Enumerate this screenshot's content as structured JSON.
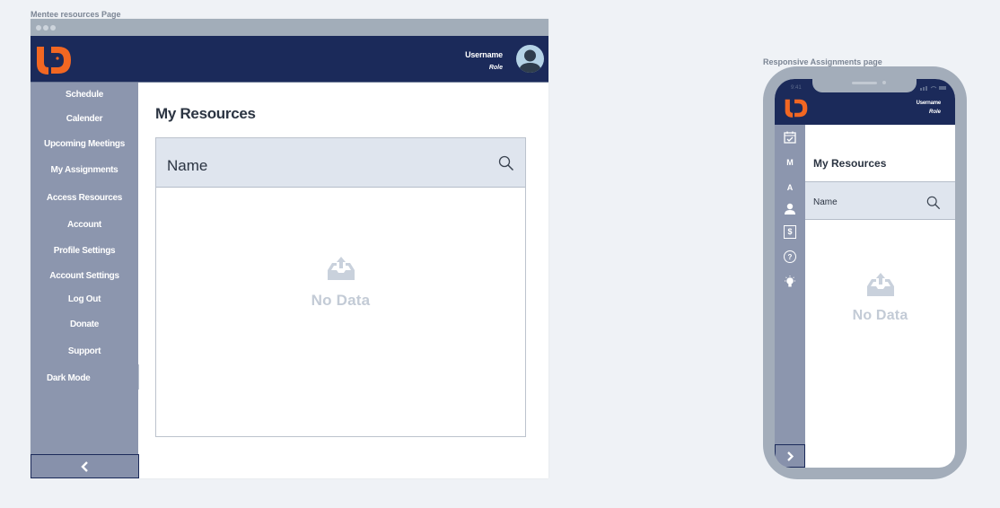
{
  "desktop": {
    "frame_label": "Mentee resources Page",
    "header": {
      "username": "Username",
      "role": "Role"
    },
    "nav": [
      {
        "label": "Schedule"
      },
      {
        "label": "Calender"
      },
      {
        "label": "Upcoming Meetings"
      },
      {
        "label": "My Assignments"
      },
      {
        "label": "Access Resources"
      },
      {
        "label": "Account"
      },
      {
        "label": "Profile Settings"
      },
      {
        "label": "Account Settings"
      },
      {
        "label": "Log Out"
      },
      {
        "label": "Donate"
      },
      {
        "label": "Support"
      },
      {
        "label": "Dark Mode"
      }
    ],
    "page_title": "My Resources",
    "table": {
      "column": "Name",
      "empty_text": "No Data"
    }
  },
  "mobile": {
    "frame_label": "Responsive Assignments page",
    "status_time": "9:41",
    "header": {
      "username": "Username",
      "role": "Role"
    },
    "nav_icons": [
      {
        "icon": "calendar-check-icon"
      },
      {
        "icon": "letter-m-icon",
        "text": "M"
      },
      {
        "icon": "letter-a-icon",
        "text": "A"
      },
      {
        "icon": "person-icon"
      },
      {
        "icon": "dollar-icon",
        "text": "$"
      },
      {
        "icon": "help-icon",
        "text": "?"
      },
      {
        "icon": "lightbulb-icon"
      }
    ],
    "page_title": "My Resources",
    "table": {
      "column": "Name",
      "empty_text": "No Data"
    }
  },
  "colors": {
    "header_navy": "#1b2a5a",
    "sidebar": "#8c96ae",
    "logo_orange": "#f26722",
    "table_header": "#dfe5ee",
    "empty_text": "#c3cbd6"
  }
}
